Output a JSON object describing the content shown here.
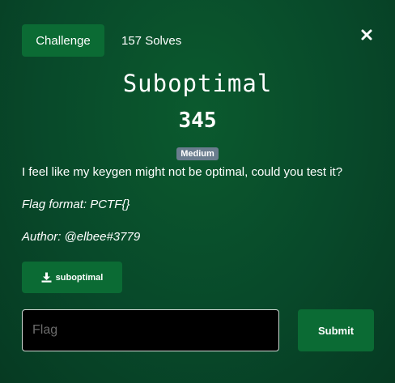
{
  "tabs": {
    "challenge_label": "Challenge",
    "solves_label": "157 Solves"
  },
  "challenge": {
    "name": "Suboptimal",
    "points": "345",
    "difficulty": "Medium",
    "description": "I feel like my keygen might not be optimal, could you test it?",
    "flag_format": "Flag format: PCTF{}",
    "author": "Author: @elbee#3779"
  },
  "files": [
    {
      "name": "suboptimal",
      "icon": "download-icon"
    }
  ],
  "submission": {
    "placeholder": "Flag",
    "value": "",
    "submit_label": "Submit"
  },
  "icons": {
    "close": "close-icon"
  },
  "colors": {
    "background": "#08492a",
    "button": "#0b6b34",
    "badge": "#6a7d8e",
    "input_background": "#000000"
  }
}
